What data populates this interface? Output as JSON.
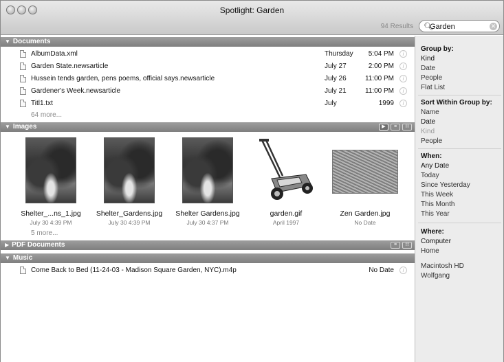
{
  "window": {
    "title": "Spotlight: Garden"
  },
  "toolbar": {
    "results": "94 Results",
    "search_value": "Garden"
  },
  "sections": {
    "documents": {
      "title": "Documents",
      "rows": [
        {
          "name": "AlbumData.xml",
          "date": "Thursday",
          "time": "5:04 PM"
        },
        {
          "name": "Garden State.newsarticle",
          "date": "July 27",
          "time": "2:00 PM"
        },
        {
          "name": "Hussein tends garden, pens poems, official says.newsarticle",
          "date": "July 26",
          "time": "11:00 PM"
        },
        {
          "name": "Gardener's Week.newsarticle",
          "date": "July 21",
          "time": "11:00 PM"
        },
        {
          "name": "Titl1.txt",
          "date": "July",
          "time": "1999"
        }
      ],
      "more": "64 more..."
    },
    "images": {
      "title": "Images",
      "items": [
        {
          "name": "Shelter_...ns_1.jpg",
          "date": "July 30 4:39 PM"
        },
        {
          "name": "Shelter_Gardens.jpg",
          "date": "July 30 4:39 PM"
        },
        {
          "name": "Shelter Gardens.jpg",
          "date": "July 30 4:37 PM"
        },
        {
          "name": "garden.gif",
          "date": "April 1997"
        },
        {
          "name": "Zen Garden.jpg",
          "date": "No Date"
        }
      ],
      "more": "5 more..."
    },
    "pdf": {
      "title": "PDF Documents"
    },
    "music": {
      "title": "Music",
      "rows": [
        {
          "name": "Come Back to Bed (11-24-03 - Madison Square Garden, NYC).m4p",
          "date": "No Date"
        }
      ]
    }
  },
  "sidebar": {
    "group_by": {
      "title": "Group by:",
      "items": [
        "Kind",
        "Date",
        "People",
        "Flat List"
      ]
    },
    "sort_by": {
      "title": "Sort Within Group by:",
      "items": [
        "Name",
        "Date",
        "Kind",
        "People"
      ]
    },
    "when": {
      "title": "When:",
      "items": [
        "Any Date",
        "Today",
        "Since Yesterday",
        "This Week",
        "This Month",
        "This Year"
      ]
    },
    "where": {
      "title": "Where:",
      "items": [
        "Computer",
        "Home",
        "Macintosh HD",
        "Wolfgang"
      ]
    }
  },
  "colors": {
    "header_bg": "#8e8e8e",
    "sidebar_bg": "#ececec"
  },
  "icons": [
    "close-button-icon",
    "minimize-button-icon",
    "zoom-button-icon",
    "search-icon",
    "clear-search-icon",
    "disclosure-triangle-icon",
    "slideshow-icon",
    "list-view-icon",
    "grid-view-icon",
    "document-icon",
    "info-icon",
    "music-file-icon"
  ]
}
